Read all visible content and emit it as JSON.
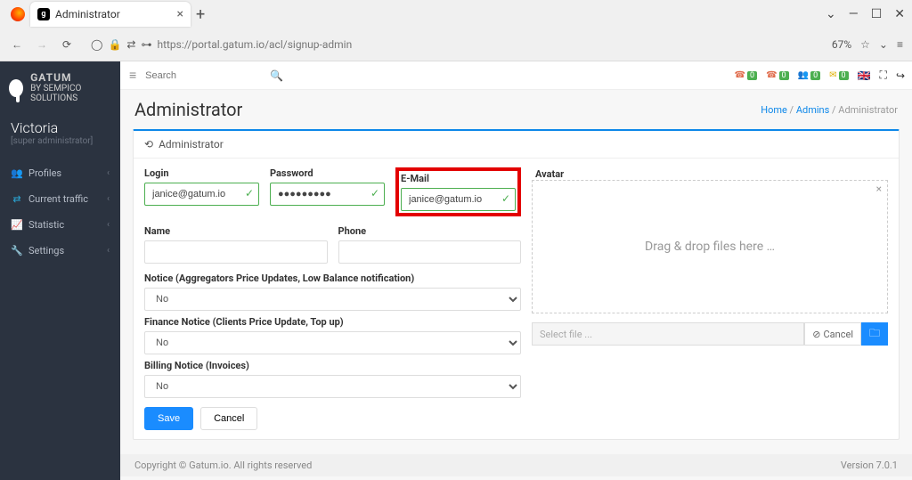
{
  "browser": {
    "tab_title": "Administrator",
    "url": "https://portal.gatum.io/acl/signup-admin",
    "zoom": "67%"
  },
  "brand": {
    "name": "GATUM",
    "by": "BY SEMPICO SOLUTIONS"
  },
  "user": {
    "name": "Victoria",
    "role": "[super administrator]"
  },
  "sidebar": {
    "items": [
      {
        "label": "Profiles"
      },
      {
        "label": "Current traffic"
      },
      {
        "label": "Statistic"
      },
      {
        "label": "Settings"
      }
    ]
  },
  "topbar": {
    "search_placeholder": "Search",
    "badge": "0"
  },
  "page": {
    "title": "Administrator"
  },
  "breadcrumb": {
    "home": "Home",
    "admins": "Admins",
    "current": "Administrator"
  },
  "card": {
    "title": "Administrator"
  },
  "form": {
    "login_label": "Login",
    "login_value": "janice@gatum.io",
    "password_label": "Password",
    "password_value": "●●●●●●●●●",
    "email_label": "E-Mail",
    "email_value": "janice@gatum.io",
    "name_label": "Name",
    "name_value": "",
    "phone_label": "Phone",
    "phone_value": "",
    "notice_label": "Notice (Aggregators Price Updates, Low Balance notification)",
    "notice_value": "No",
    "finance_label": "Finance Notice (Clients Price Update, Top up)",
    "finance_value": "No",
    "billing_label": "Billing Notice (Invoices)",
    "billing_value": "No",
    "save": "Save",
    "cancel": "Cancel"
  },
  "avatar": {
    "label": "Avatar",
    "drop_text": "Drag & drop files here …",
    "select_placeholder": "Select file ...",
    "cancel": "Cancel"
  },
  "footer": {
    "copyright": "Copyright © Gatum.io. All rights reserved",
    "version_label": "Version ",
    "version": "7.0.1"
  }
}
